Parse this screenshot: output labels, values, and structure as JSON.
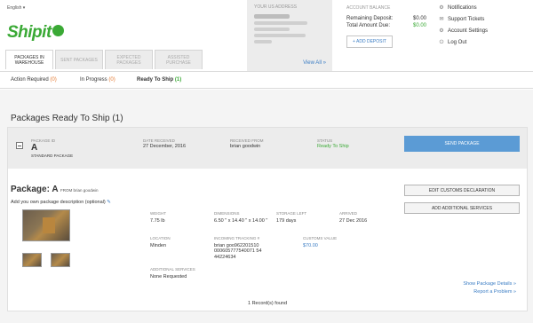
{
  "header": {
    "language": "English",
    "logo": "Shipito"
  },
  "tabs": [
    {
      "label": "Packages in Warehouse",
      "active": true
    },
    {
      "label": "Sent Packages",
      "active": false
    },
    {
      "label": "Expected Packages",
      "active": false
    },
    {
      "label": "Assisted Purchase",
      "active": false
    }
  ],
  "address": {
    "heading": "Your US Address",
    "view_all": "View All"
  },
  "balance": {
    "heading": "Account Balance",
    "remaining_label": "Remaining Deposit:",
    "remaining_value": "$0.00",
    "due_label": "Total Amount Due:",
    "due_value": "$0.00",
    "add_deposit": "+ Add Deposit"
  },
  "menu": [
    {
      "label": "Notifications",
      "icon": "gear-icon"
    },
    {
      "label": "Support Tickets",
      "icon": "support-icon"
    },
    {
      "label": "Account Settings",
      "icon": "gear-icon"
    },
    {
      "label": "Log Out",
      "icon": "power-icon"
    }
  ],
  "subnav": {
    "action_required": {
      "label": "Action Required",
      "count": "(0)"
    },
    "in_progress": {
      "label": "In Progress",
      "count": "(0)"
    },
    "ready_to_ship": {
      "label": "Ready To Ship",
      "count": "(1)"
    }
  },
  "page_title": "Packages Ready To Ship (1)",
  "package": {
    "id_label": "Package ID",
    "id_value": "A",
    "type": "Standard Package",
    "date_label": "Date Received",
    "date_value": "27 December, 2016",
    "from_label": "Received From",
    "from_value": "brian goodwin",
    "status_label": "Status",
    "status_value": "Ready To Ship",
    "send_button": "Send Package",
    "title": "Package: A",
    "title_from": "FROM brian goodwin",
    "desc_prompt": "Add you own package description (optional)",
    "edit_customs": "Edit Customs Declaration",
    "add_services": "Add Additional Services",
    "weight_label": "Weight",
    "weight_value": "7.75 lb",
    "dimensions_label": "Dimensions",
    "dimensions_value": "6.50 \" x 14.40 \" x 14.00 \"",
    "storage_label": "Storage Left",
    "storage_value": "179 days",
    "arrived_label": "Arrived",
    "arrived_value": "27 Dec 2016",
    "location_label": "Location",
    "location_value": "Minden",
    "tracking_label": "Incoming Tracking #",
    "tracking_value_1": "brian goo962201510",
    "tracking_value_2": "000605777540071 54",
    "tracking_value_3": "44224634",
    "customs_label": "Customs Value",
    "customs_value": "$70.00",
    "services_label": "Additional Services",
    "services_value": "None Requested",
    "show_details": "Show Package Details »",
    "report_problem": "Report a Problem »"
  },
  "footer": "1 Record(s) found"
}
